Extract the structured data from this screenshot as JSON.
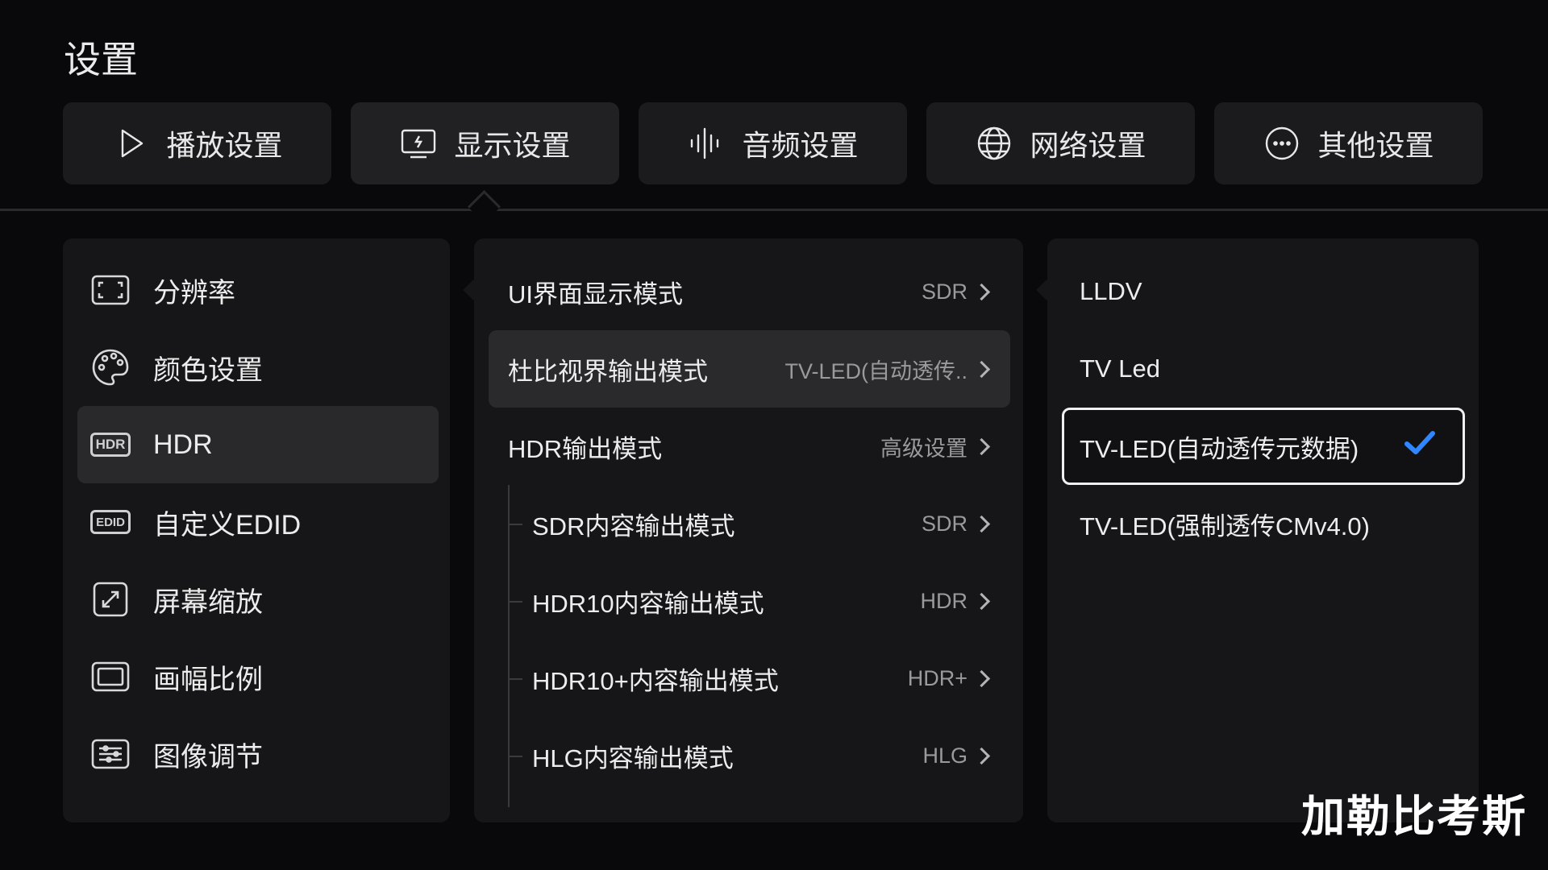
{
  "page_title": "设置",
  "tabs": [
    {
      "label": "播放设置",
      "icon": "play-icon",
      "active": false
    },
    {
      "label": "显示设置",
      "icon": "display-icon",
      "active": true
    },
    {
      "label": "音频设置",
      "icon": "audio-wave-icon",
      "active": false
    },
    {
      "label": "网络设置",
      "icon": "globe-icon",
      "active": false
    },
    {
      "label": "其他设置",
      "icon": "more-icon",
      "active": false
    }
  ],
  "left_menu": [
    {
      "label": "分辨率",
      "icon": "resolution-icon"
    },
    {
      "label": "颜色设置",
      "icon": "palette-icon"
    },
    {
      "label": "HDR",
      "icon": "hdr-icon",
      "icon_text": "HDR",
      "selected": true
    },
    {
      "label": "自定义EDID",
      "icon": "edid-icon",
      "icon_text": "EDID"
    },
    {
      "label": "屏幕缩放",
      "icon": "zoom-icon"
    },
    {
      "label": "画幅比例",
      "icon": "aspect-ratio-icon"
    },
    {
      "label": "图像调节",
      "icon": "image-adjust-icon"
    }
  ],
  "middle_menu": [
    {
      "label": "UI界面显示模式",
      "value": "SDR"
    },
    {
      "label": "杜比视界输出模式",
      "value": "TV-LED(自动透传..",
      "focused": true
    },
    {
      "label": "HDR输出模式",
      "value": "高级设置"
    },
    {
      "label": "SDR内容输出模式",
      "value": "SDR",
      "sub": true
    },
    {
      "label": "HDR10内容输出模式",
      "value": "HDR",
      "sub": true
    },
    {
      "label": "HDR10+内容输出模式",
      "value": "HDR+",
      "sub": true
    },
    {
      "label": "HLG内容输出模式",
      "value": "HLG",
      "sub": true
    }
  ],
  "right_options": [
    {
      "label": "LLDV"
    },
    {
      "label": "TV Led"
    },
    {
      "label": "TV-LED(自动透传元数据)",
      "checked": true
    },
    {
      "label": "TV-LED(强制透传CMv4.0)"
    }
  ],
  "colors": {
    "accent_check": "#2f86ff",
    "background": "#09090b",
    "panel": "#161618"
  },
  "watermark": "加勒比考斯"
}
